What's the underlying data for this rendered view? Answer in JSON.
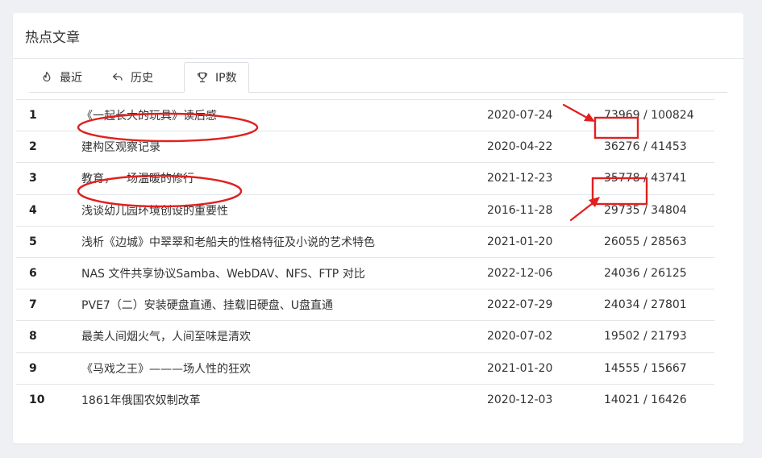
{
  "header": {
    "title": "热点文章"
  },
  "tabs": [
    {
      "label": "最近",
      "icon": "flame-icon",
      "active": false
    },
    {
      "label": "历史",
      "icon": "reply-icon",
      "active": false
    },
    {
      "label": "IP数",
      "icon": "trophy-icon",
      "active": true
    }
  ],
  "articles": [
    {
      "rank": "1",
      "title": "《一起长大的玩具》读后感",
      "date": "2020-07-24",
      "ip": "73969",
      "pv": "100824"
    },
    {
      "rank": "2",
      "title": "建构区观察记录",
      "date": "2020-04-22",
      "ip": "36276",
      "pv": "41453"
    },
    {
      "rank": "3",
      "title": "教育，一场温暖的修行",
      "date": "2021-12-23",
      "ip": "35778",
      "pv": "43741"
    },
    {
      "rank": "4",
      "title": "浅谈幼儿园环境创设的重要性",
      "date": "2016-11-28",
      "ip": "29735",
      "pv": "34804"
    },
    {
      "rank": "5",
      "title": "浅析《边城》中翠翠和老船夫的性格特征及小说的艺术特色",
      "date": "2021-01-20",
      "ip": "26055",
      "pv": "28563"
    },
    {
      "rank": "6",
      "title": "NAS 文件共享协议Samba、WebDAV、NFS、FTP 对比",
      "date": "2022-12-06",
      "ip": "24036",
      "pv": "26125"
    },
    {
      "rank": "7",
      "title": "PVE7（二）安装硬盘直通、挂载旧硬盘、U盘直通",
      "date": "2022-07-29",
      "ip": "24034",
      "pv": "27801"
    },
    {
      "rank": "8",
      "title": "最美人间烟火气，人间至味是清欢",
      "date": "2020-07-02",
      "ip": "19502",
      "pv": "21793"
    },
    {
      "rank": "9",
      "title": "《马戏之王》———场人性的狂欢",
      "date": "2021-01-20",
      "ip": "14555",
      "pv": "15667"
    },
    {
      "rank": "10",
      "title": "1861年俄国农奴制改革",
      "date": "2020-12-03",
      "ip": "14021",
      "pv": "16426"
    }
  ],
  "separator": " / ",
  "annotation_color": "#e02020"
}
